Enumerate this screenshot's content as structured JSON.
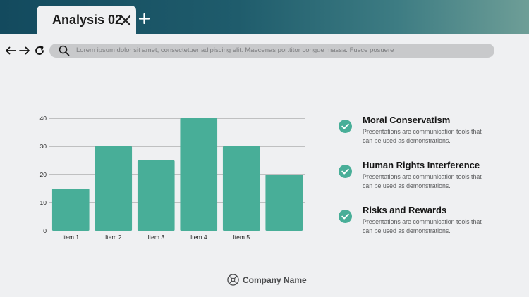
{
  "window": {
    "tab_title": "Analysis 02",
    "tab_close_icon": "close-icon",
    "tab_add_icon": "plus-icon",
    "gradient_colors": [
      "#134a5e",
      "#6e9e97"
    ]
  },
  "toolbar": {
    "back_icon": "arrow-left-icon",
    "forward_icon": "arrow-right-icon",
    "reload_icon": "reload-icon",
    "search_icon": "search-icon",
    "search_text": "Lorem ipsum dolor sit amet, consectetuer adipiscing elit. Maecenas porttitor congue massa. Fusce posuere"
  },
  "chart_data": {
    "type": "bar",
    "categories": [
      "Item 1",
      "Item 2",
      "Item 3",
      "Item 4",
      "Item 5",
      ""
    ],
    "values": [
      15,
      30,
      25,
      40,
      30,
      20
    ],
    "yticks": [
      0,
      10,
      20,
      30,
      40
    ],
    "ylim": [
      0,
      40
    ],
    "grid": true,
    "bar_color": "#48ae98",
    "title": "",
    "xlabel": "",
    "ylabel": ""
  },
  "features": [
    {
      "title": "Moral Conservatism",
      "desc": "Presentations are communication tools that can be used as demonstrations."
    },
    {
      "title": "Human Rights Interference",
      "desc": "Presentations are communication tools that can be used as demonstrations."
    },
    {
      "title": "Risks and Rewards",
      "desc": "Presentations are communication tools that can be used as demonstrations."
    }
  ],
  "check_color": "#48ae98",
  "footer": {
    "company_name": "Company Name",
    "company_icon": "logo-icon"
  }
}
